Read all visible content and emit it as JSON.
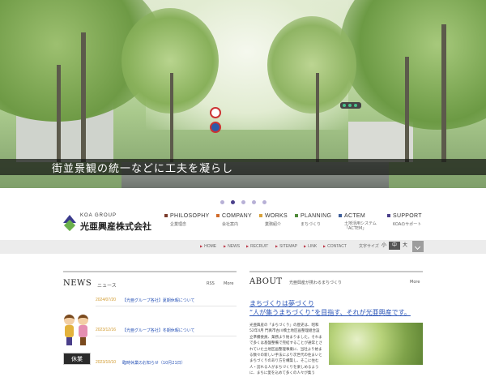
{
  "hero": {
    "caption": "街並景観の統一などに工夫を凝らし",
    "slides": 6,
    "active_slide": 2
  },
  "logo": {
    "en": "KOA GROUP",
    "jp": "光亜興産株式会社"
  },
  "global_nav": [
    {
      "en": "PHILOSOPHY",
      "jp": "企業理念",
      "color": "#7a3a2a"
    },
    {
      "en": "COMPANY",
      "jp": "会社案内",
      "color": "#d06a2a"
    },
    {
      "en": "WORKS",
      "jp": "業務紹介",
      "color": "#d9a23a"
    },
    {
      "en": "PLANNING",
      "jp": "まちづくり",
      "color": "#4f8a3a"
    },
    {
      "en": "ACTEM",
      "jp": "土地活用システム「ACTEM」",
      "color": "#3f5f9a"
    },
    {
      "en": "SUPPORT",
      "jp": "KOAのサポート",
      "color": "#4a3f8a"
    }
  ],
  "sub_nav": [
    "HOME",
    "NEWS",
    "RECRUIT",
    "SITEMAP",
    "LINK",
    "CONTACT"
  ],
  "font_size": {
    "label": "文字サイズ",
    "options": [
      "小",
      "中",
      "大"
    ],
    "selected": "中"
  },
  "news": {
    "title": "NEWS",
    "subtitle": "ニュース",
    "rss": "RSS",
    "more": "More",
    "items": [
      {
        "date": "2024/07/20",
        "text": "【光亜グループ各社】夏期休暇について"
      },
      {
        "date": "2023/12/16",
        "text": "【光亜グループ各社】冬期休暇について"
      },
      {
        "date": "2023/10/10",
        "text": "臨時休業のお知らせ（10月21日）"
      }
    ],
    "closed_label": "休業"
  },
  "about": {
    "title": "ABOUT",
    "subtitle": "光亜興産が携わるまちづくり",
    "more": "More",
    "catch1": "まちづくりは夢づくり",
    "catch2": "“人が集うまちづくり”を目指す、それが光亜興産です。",
    "body": "光亜興産の「まちづくり」の歴史は、昭和52年4月 門真市古川橋土地区画整理組合設立準備委員、業務より始まりました。それまで多くは基盤整備で完結することが通常とされていた土地区画整理事業に、当社より始まる数々の新しい手法により次世代の住まいとまちづくりのあり方を構築し、そこに住む人・訪れる人がまちづくりを楽しめるように、まちに愛を込めて多くの人々が集う"
  }
}
